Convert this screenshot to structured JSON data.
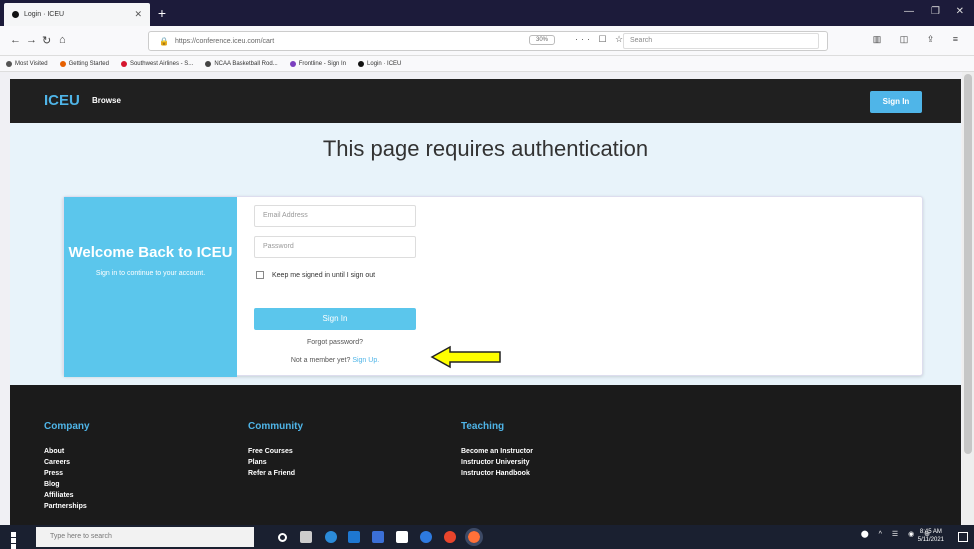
{
  "browser": {
    "tab_title": "Login · ICEU",
    "url": "https://conference.iceu.com/cart",
    "zoom": "30%",
    "search_placeholder": "Search",
    "bookmarks": [
      {
        "label": "Most Visited",
        "color": "#555555"
      },
      {
        "label": "Getting Started",
        "color": "#e66000"
      },
      {
        "label": "Southwest Airlines - S...",
        "color": "#d5152e"
      },
      {
        "label": "NCAA Basketball Rod...",
        "color": "#444444"
      },
      {
        "label": "Frontline - Sign In",
        "color": "#7b3fbf"
      },
      {
        "label": "Login · ICEU",
        "color": "#111111"
      }
    ]
  },
  "site_header": {
    "logo": "ICEU",
    "browse": "Browse",
    "sign_in": "Sign In"
  },
  "main": {
    "title": "This page requires authentication",
    "welcome_title": "Welcome Back to ICEU",
    "welcome_subtitle": "Sign in to continue to your account.",
    "email_placeholder": "Email Address",
    "password_placeholder": "Password",
    "keep_signed_in": "Keep me signed in until I sign out",
    "sign_in_button": "Sign In",
    "forgot": "Forgot password?",
    "not_member": "Not a member yet?",
    "sign_up": "Sign Up."
  },
  "footer": {
    "company": {
      "title": "Company",
      "items": [
        "About",
        "Careers",
        "Press",
        "Blog",
        "Affiliates",
        "Partnerships"
      ]
    },
    "community": {
      "title": "Community",
      "items": [
        "Free Courses",
        "Plans",
        "Refer a Friend"
      ]
    },
    "teaching": {
      "title": "Teaching",
      "items": [
        "Become an Instructor",
        "Instructor University",
        "Instructor Handbook"
      ]
    }
  },
  "taskbar": {
    "search_placeholder": "Type here to search",
    "time": "8:45 AM",
    "date": "5/11/2021"
  },
  "colors": {
    "accent": "#4fb5e8",
    "arrow": "#ffff00"
  }
}
